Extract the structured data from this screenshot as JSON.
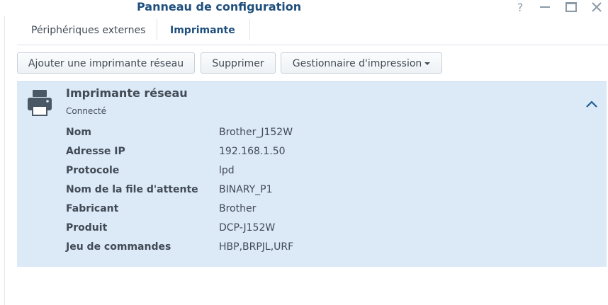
{
  "window": {
    "title": "Panneau de configuration",
    "help_symbol": "?"
  },
  "tabs": [
    {
      "label": "Périphériques externes",
      "active": false
    },
    {
      "label": "Imprimante",
      "active": true
    }
  ],
  "toolbar": {
    "add_label": "Ajouter une imprimante réseau",
    "delete_label": "Supprimer",
    "manager_label": "Gestionnaire d'impression"
  },
  "printer": {
    "title": "Imprimante réseau",
    "status": "Connecté",
    "details": [
      {
        "key": "Nom",
        "value": "Brother_J152W"
      },
      {
        "key": "Adresse IP",
        "value": "192.168.1.50"
      },
      {
        "key": "Protocole",
        "value": "lpd"
      },
      {
        "key": "Nom de la file d'attente",
        "value": "BINARY_P1"
      },
      {
        "key": "Fabricant",
        "value": "Brother"
      },
      {
        "key": "Produit",
        "value": "DCP-J152W"
      },
      {
        "key": "Jeu de commandes",
        "value": "HBP,BRPJL,URF"
      }
    ]
  },
  "colors": {
    "accent": "#1f4f7d",
    "panel_bg": "#dce9f7",
    "icon": "#4a5866"
  },
  "icons": {
    "printer": "printer-icon",
    "collapse": "chevron-up-icon",
    "help": "help-icon",
    "minimize": "minimize-icon",
    "maximize": "maximize-icon",
    "close": "close-icon"
  }
}
